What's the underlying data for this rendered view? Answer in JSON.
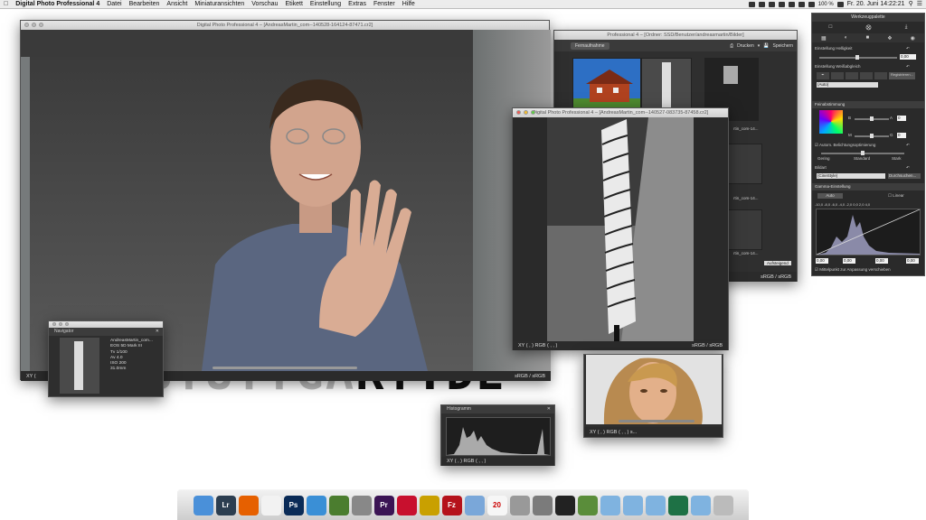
{
  "menubar": {
    "app_name": "Digital Photo Professional 4",
    "items": [
      "Datei",
      "Bearbeiten",
      "Ansicht",
      "Miniaturansichten",
      "Vorschau",
      "Etikett",
      "Einstellung",
      "Extras",
      "Fenster",
      "Hilfe"
    ],
    "battery": "100 %",
    "clock": "Fr. 20. Juni  14:22:21"
  },
  "backdrop_text": {
    "faded": "STUTTGA",
    "dark": "RT.DE"
  },
  "main_window": {
    "title": "Digital Photo Professional 4 – [AndreasMartin_com--140528-164124-87471.cr2]",
    "status_left": "XY (",
    "status_right": "sRGB / sRGB"
  },
  "browser_window": {
    "title": "Professional 4 – [Ordner: SSD/Benutzer/andreasmartin/Bilder]",
    "fernaufnahme": "Fernaufnahme",
    "drucken": "Drucken",
    "speichern": "Speichern",
    "thumb_caption1": "rtin_com-14...",
    "thumb_caption2": "rtin_com-14...",
    "thumb_caption3": "rtin_com-14...",
    "aufsteigend": "Aufsteigend",
    "status_right": "sRGB / sRGB"
  },
  "preview_window": {
    "title": "Digital Photo Professional 4 – [AndreasMartin_com--140527-083735-87458.cr2]",
    "status_left": "XY (       ,        )  RGB (       ,        ,        )",
    "status_right": "sRGB / sRGB"
  },
  "navigator": {
    "title": "Navigator",
    "close": "✕",
    "info": [
      "AndreasMartin_com...",
      "EOS 5D Mark III",
      "Tv 1/100",
      "Av 4.0",
      "ISO 200",
      "31.0mm"
    ]
  },
  "histogram_window": {
    "title": "Histogramm",
    "close": "✕",
    "status": "XY (       ,       )  RGB (       ,       ,       )"
  },
  "woman_window": {
    "status": "XY (       ,       )  RGB (       ,       ,       )  s..."
  },
  "palette": {
    "title": "Werkzeugpalette",
    "helligkeit": "Einstellung Helligkeit",
    "helligkeit_value": "0,00",
    "weissabgleich": "Einstellung Weißabgleich",
    "registrieren": "Registrieren...",
    "auto": "(Auto)",
    "feinabstimmung": "Feinabstimmung",
    "b_label": "B",
    "a_label": "A",
    "m_label": "M",
    "g_label": "G",
    "b_value": "0",
    "g_value": "0",
    "auto_belichtung": "Autom. Belichtungsoptimierung",
    "gering": "Gering",
    "standard": "Standard",
    "stark": "Stark",
    "bildart": "Bildart",
    "bildart_value": "(CineStyle)",
    "durchsuchen": "Durchsuchen...",
    "gamma": "Gamma-Einstellung",
    "auto_btn": "Auto",
    "linear": "Linear",
    "scale": "-10,0 -8,0 -6,0 -4,0 -2,0  0,0  2,0  4,0",
    "v1": "0,00",
    "v2": "0,00",
    "v3": "0,00",
    "v4": "0,00",
    "mittelpunkt": "Mittelpunkt zur Anpassung verschieben"
  },
  "dock": {
    "icons": [
      {
        "name": "finder-icon",
        "label": "",
        "color": "#4a90d9"
      },
      {
        "name": "lightroom-icon",
        "label": "Lr",
        "color": "#2c3e50"
      },
      {
        "name": "firefox-icon",
        "label": "",
        "color": "#e66000"
      },
      {
        "name": "document-icon",
        "label": "",
        "color": "#f2f2f2"
      },
      {
        "name": "photoshop-icon",
        "label": "Ps",
        "color": "#0a2b57"
      },
      {
        "name": "safari-icon",
        "label": "",
        "color": "#3a8fd6"
      },
      {
        "name": "sync-icon",
        "label": "",
        "color": "#4b7d2f"
      },
      {
        "name": "keyboard-icon",
        "label": "",
        "color": "#888"
      },
      {
        "name": "premiere-icon",
        "label": "Pr",
        "color": "#3b1454"
      },
      {
        "name": "acrobat-icon",
        "label": "",
        "color": "#c8102e"
      },
      {
        "name": "ftp-icon",
        "label": "",
        "color": "#c9a000"
      },
      {
        "name": "filezilla-icon",
        "label": "Fz",
        "color": "#b5121b"
      },
      {
        "name": "preview-icon",
        "label": "",
        "color": "#7aa7d9"
      },
      {
        "name": "calendar-icon",
        "label": "20",
        "color": "#f6f6f6"
      },
      {
        "name": "calculator-icon",
        "label": "",
        "color": "#999"
      },
      {
        "name": "system-preferences-icon",
        "label": "",
        "color": "#7b7b7b"
      },
      {
        "name": "camera-icon",
        "label": "",
        "color": "#222"
      },
      {
        "name": "brush-icon",
        "label": "",
        "color": "#5a8d3a"
      },
      {
        "name": "folder-icon",
        "label": "",
        "color": "#7fb3e0"
      },
      {
        "name": "downloads-folder-icon",
        "label": "",
        "color": "#7fb3e0"
      },
      {
        "name": "folder-icon-2",
        "label": "",
        "color": "#7fb3e0"
      },
      {
        "name": "excel-icon",
        "label": "",
        "color": "#1e7145"
      },
      {
        "name": "folder-icon-3",
        "label": "",
        "color": "#7fb3e0"
      },
      {
        "name": "trash-icon",
        "label": "",
        "color": "#bbb"
      }
    ]
  }
}
